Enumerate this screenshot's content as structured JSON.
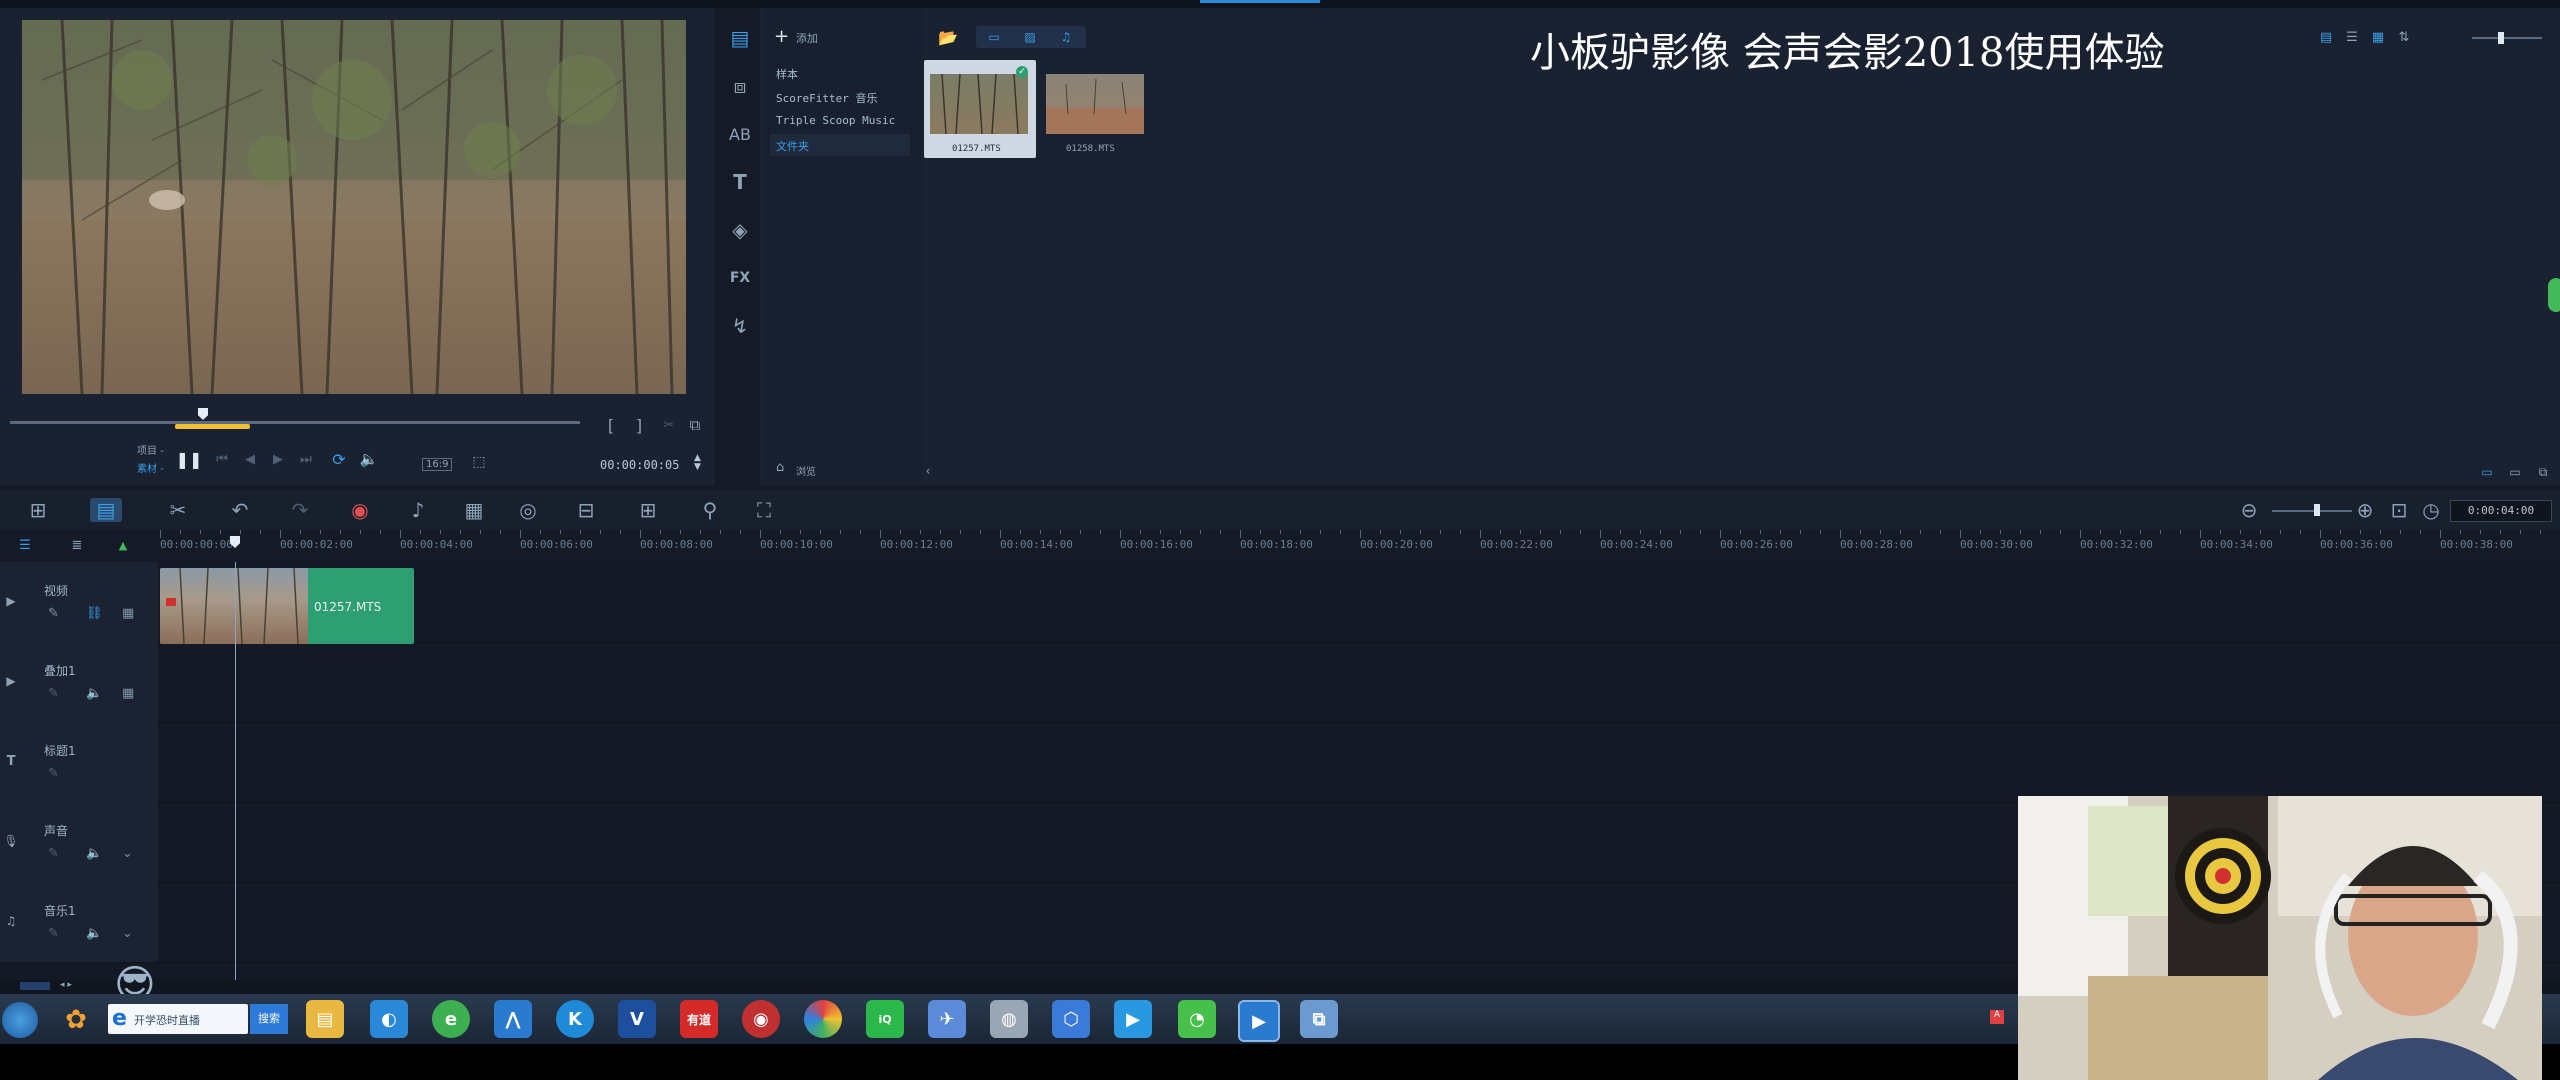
{
  "overlay_title": "小板驴影像 会声会影2018使用体验",
  "player": {
    "mode_project": "项目 -",
    "mode_clip": "素材 -",
    "timecode": "00:00:00:05",
    "zoom_label": "16:9"
  },
  "library": {
    "add_label": "添加",
    "folders": [
      "样本",
      "ScoreFitter 音乐",
      "Triple Scoop Music",
      "文件夹"
    ],
    "browse_label": "浏览",
    "thumbnails": [
      {
        "name": "01257.MTS",
        "selected": true
      },
      {
        "name": "01258.MTS",
        "selected": false
      }
    ]
  },
  "timeline": {
    "duration": "0:00:04:00",
    "ruler": [
      "00:00:00:00",
      "00:00:02:00",
      "00:00:04:00",
      "00:00:06:00",
      "00:00:08:00",
      "00:00:10:00",
      "00:00:12:00",
      "00:00:14:00",
      "00:00:16:00",
      "00:00:18:00",
      "00:00:20:00",
      "00:00:22:00",
      "00:00:24:00",
      "00:00:26:00",
      "00:00:28:00",
      "00:00:30:00",
      "00:00:32:00",
      "00:00:34:00",
      "00:00:36:00",
      "00:00:38:00"
    ],
    "tracks": [
      {
        "name": "视频",
        "icon": "video-track-icon"
      },
      {
        "name": "叠加1",
        "icon": "overlay-track-icon"
      },
      {
        "name": "标题1",
        "icon": "title-track-icon"
      },
      {
        "name": "声音",
        "icon": "voice-track-icon"
      },
      {
        "name": "音乐1",
        "icon": "music-track-icon"
      }
    ],
    "clip_label": "01257.MTS"
  },
  "taskbar": {
    "search_text": "开学恐时直播",
    "search_button": "搜索",
    "youdao_label": "有道"
  },
  "colors": {
    "accent": "#1e90ff",
    "clip_green": "#2e9e73",
    "panel": "#1a2231",
    "bg": "#151b26"
  }
}
